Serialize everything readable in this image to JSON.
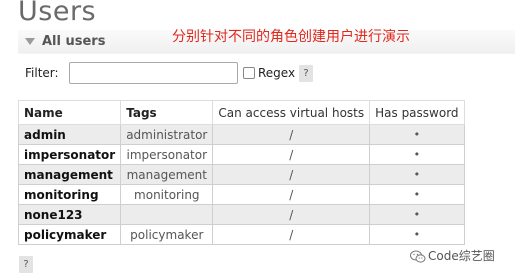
{
  "page": {
    "title": "Users"
  },
  "section": {
    "title": "All users"
  },
  "annotation": "分别针对不同的角色创建用户进行演示",
  "filter": {
    "label": "Filter:",
    "value": "",
    "regex_label": "Regex",
    "help": "?"
  },
  "table": {
    "headers": [
      "Name",
      "Tags",
      "Can access virtual hosts",
      "Has password"
    ],
    "rows": [
      {
        "name": "admin",
        "tags": "administrator",
        "vhosts": "/",
        "has_password": "•"
      },
      {
        "name": "impersonator",
        "tags": "impersonator",
        "vhosts": "/",
        "has_password": "•"
      },
      {
        "name": "management",
        "tags": "management",
        "vhosts": "/",
        "has_password": "•"
      },
      {
        "name": "monitoring",
        "tags": "monitoring",
        "vhosts": "/",
        "has_password": "•"
      },
      {
        "name": "none123",
        "tags": "",
        "vhosts": "/",
        "has_password": "•"
      },
      {
        "name": "policymaker",
        "tags": "policymaker",
        "vhosts": "/",
        "has_password": "•"
      }
    ]
  },
  "footer": {
    "help": "?"
  },
  "watermark": "Code综艺圈",
  "colors": {
    "annotation": "#e0281e",
    "row_alt": "#ececec"
  },
  "icons": {
    "section_toggle": "triangle-down-icon",
    "watermark": "wechat-icon"
  }
}
